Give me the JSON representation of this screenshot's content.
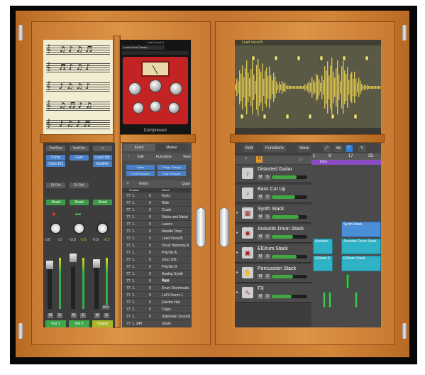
{
  "compressor": {
    "header": "Lead Vocal 8",
    "preset": "Lead Vocal Classic",
    "title": "Compressor"
  },
  "mixer": {
    "strips": [
      {
        "setting": "TestOsc",
        "plugins": [
          "Comp",
          "Chan EQ"
        ],
        "out": "St Out",
        "automation": "Read",
        "pan_left": "0.0",
        "pan_right": "-10",
        "mute": "M",
        "solo": "S",
        "name": "Inst 1",
        "name_color": "#3fa64a"
      },
      {
        "setting": "TestOsc",
        "plugins": [
          "Gain"
        ],
        "out": "St Out",
        "automation": "Read",
        "pan_left": "+3.0",
        "pan_right": "-1.6",
        "mute": "M",
        "solo": "S",
        "name": "Inst 2",
        "name_color": "#3fa64a"
      },
      {
        "setting": "",
        "plugins": [
          "Level Mtr",
          "MultiMtr"
        ],
        "out": "",
        "automation": "Read",
        "pan_left": "-0.9",
        "pan_right": "-0.7",
        "mute": "M",
        "solo": "S",
        "name": "Output",
        "name_color": "#a7b62a",
        "bounce": "Bnc"
      }
    ]
  },
  "event_list": {
    "tabs": [
      "Event",
      "Marker"
    ],
    "menus": [
      "Edit",
      "Functions",
      "View"
    ],
    "filters": [
      "Notes",
      "Progr. Change",
      "Chnl Pressure",
      "Poly Pressure"
    ],
    "section": "Notes",
    "quant_label": "Quan",
    "columns": [
      "Position",
      "Name"
    ],
    "rows": [
      {
        "pos": "77. 1.",
        "val": "0",
        "name": "Kicks"
      },
      {
        "pos": "77. 1.",
        "val": "0",
        "name": "Ride"
      },
      {
        "pos": "77. 1.",
        "val": "0",
        "name": "Crash"
      },
      {
        "pos": "77. 1.",
        "val": "0",
        "name": "Sticks and Metal"
      },
      {
        "pos": "77. 1.",
        "val": "0",
        "name": "Lasers"
      },
      {
        "pos": "77. 1.",
        "val": "0",
        "name": "Needle Drop"
      },
      {
        "pos": "77. 1.",
        "val": "0",
        "name": "Lead Vocal B"
      },
      {
        "pos": "77. 1.",
        "val": "0",
        "name": "Vocal Harmony A"
      },
      {
        "pos": "77. 1.",
        "val": "0",
        "name": "PolySix A"
      },
      {
        "pos": "77. 1.",
        "val": "0",
        "name": "Juno 106"
      },
      {
        "pos": "77. 1.",
        "val": "0",
        "name": "PolySix B"
      },
      {
        "pos": "77. 1.",
        "val": "0",
        "name": "Analog Synth Bass"
      },
      {
        "pos": "77. 1.",
        "val": "0",
        "name": "Hats"
      },
      {
        "pos": "77. 1.",
        "val": "0",
        "name": "Drum Overheads"
      },
      {
        "pos": "77. 1.",
        "val": "0",
        "name": "LoFi Drums 1"
      },
      {
        "pos": "77. 1.",
        "val": "0",
        "name": "Electric Hat"
      },
      {
        "pos": "77. 1.",
        "val": "0",
        "name": "Claps"
      },
      {
        "pos": "77. 1.",
        "val": "0",
        "name": "Sidechain Sounds"
      },
      {
        "pos": "77. 1. 240",
        "val": "",
        "name": "Snare"
      }
    ]
  },
  "waveform": {
    "region_name": "Lead Vocal B"
  },
  "arrange": {
    "menus": [
      "Edit",
      "Functions",
      "View"
    ],
    "ruler": [
      "1",
      "9",
      "17",
      "25"
    ],
    "marker": "Intro",
    "tracks": [
      {
        "name": "Distorted Guitar",
        "icon": "guitar-icon",
        "glyph": "♪",
        "stack": false,
        "volume": 0.7
      },
      {
        "name": "Bass Cut Up",
        "icon": "bass-icon",
        "glyph": "♪",
        "stack": false,
        "volume": 0.65
      },
      {
        "name": "Synth Stack",
        "icon": "synth-icon",
        "glyph": "▦",
        "stack": true,
        "volume": 0.75
      },
      {
        "name": "Acoustic Drum Stack",
        "icon": "drums-icon",
        "glyph": "◉",
        "stack": true,
        "volume": 0.6
      },
      {
        "name": "ElDrum Stack",
        "icon": "electronic-drum-icon",
        "glyph": "▣",
        "stack": true,
        "volume": 0.7
      },
      {
        "name": "Percussion Stack",
        "icon": "percussion-icon",
        "glyph": "✋",
        "stack": true,
        "volume": 0.6
      },
      {
        "name": "FX",
        "icon": "fx-icon",
        "glyph": "∿",
        "stack": true,
        "volume": 0.55
      }
    ],
    "regions": [
      "Synth Stack",
      "Acoustic",
      "Acoustic Drum Stack",
      "ElDrum S",
      "ElDrum Stack"
    ]
  },
  "colors": {
    "wood": "#d28638",
    "region_cyan": "#2fb1c6",
    "region_blue": "#4b8ed8",
    "region_green": "#46c45a",
    "waveform": "#d8c24e"
  }
}
